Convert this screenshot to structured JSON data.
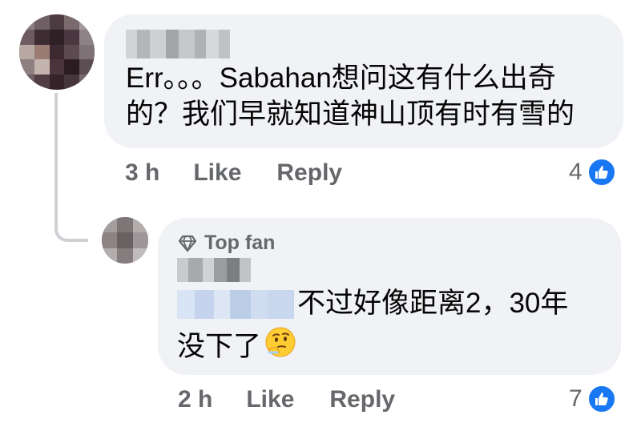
{
  "comments": [
    {
      "text_line1": "Err。。。Sabahan想问这有什么出奇",
      "text_line2": "的？我们早就知道神山顶有时有雪的",
      "time": "3 h",
      "like_label": "Like",
      "reply_label": "Reply",
      "reaction_count": "4",
      "reaction_type": "like-icon"
    }
  ],
  "reply": {
    "badge": "Top fan",
    "badge_icon": "diamond-icon",
    "text_line1": "不过好像距离2，30年",
    "text_line2": "没下了",
    "emoji": "thinking-face-emoji",
    "time": "2 h",
    "like_label": "Like",
    "reply_label": "Reply",
    "reaction_count": "7",
    "reaction_type": "like-icon"
  },
  "colors": {
    "bubble": "#f0f2f5",
    "meta_text": "#65676b",
    "like_blue": "#1877f2",
    "thread_line": "#ced0d4"
  }
}
